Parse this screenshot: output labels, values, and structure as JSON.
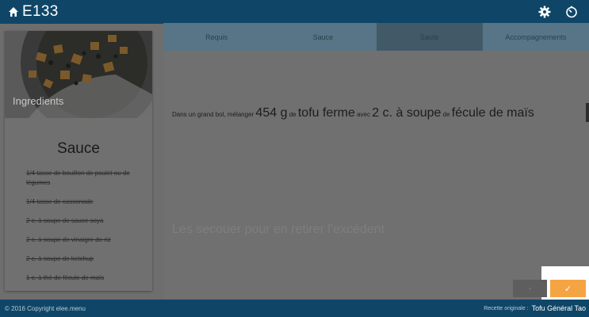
{
  "header": {
    "title": "E133",
    "icons": [
      "home-icon",
      "gear-icon",
      "timer-icon"
    ]
  },
  "ingredients_card": {
    "image_label": "Ingredients",
    "section_title": "Sauce",
    "items": [
      "1/4 tasse de bouillon de poulet ou de légumes",
      "1/4 tasse de cassonade",
      "2 c. à soupe de sauce soya",
      "2 c. à soupe de vinaigre de riz",
      "2 c. à soupe de ketchup",
      "1 c. à thé de fécule de maïs"
    ]
  },
  "tabs": [
    {
      "label": "Requis",
      "active": false
    },
    {
      "label": "Sauce",
      "active": false
    },
    {
      "label": "Saute",
      "active": true
    },
    {
      "label": "Accompagnements",
      "active": false
    }
  ],
  "instruction": {
    "prefix": "Dans un grand bol, mélanger",
    "qty1": "454 g",
    "de1": "de",
    "item1": "tofu ferme",
    "avec": "avec",
    "qty2": "2 c. à soupe",
    "de2": "de",
    "item2": "fécule de maïs"
  },
  "next_instruction": "Les secouer pour en retirer l'excédent",
  "buttons": {
    "prev_label": "-",
    "confirm_label": "✓"
  },
  "footer": {
    "copyright": "© 2016 Copyright elee.menu",
    "recipe_label": "Recette originale :",
    "recipe_name": "Tofu Général Tao"
  },
  "colors": {
    "header_bg": "#0f4668",
    "accent": "#f5a443",
    "tab_active": "#425a67"
  }
}
